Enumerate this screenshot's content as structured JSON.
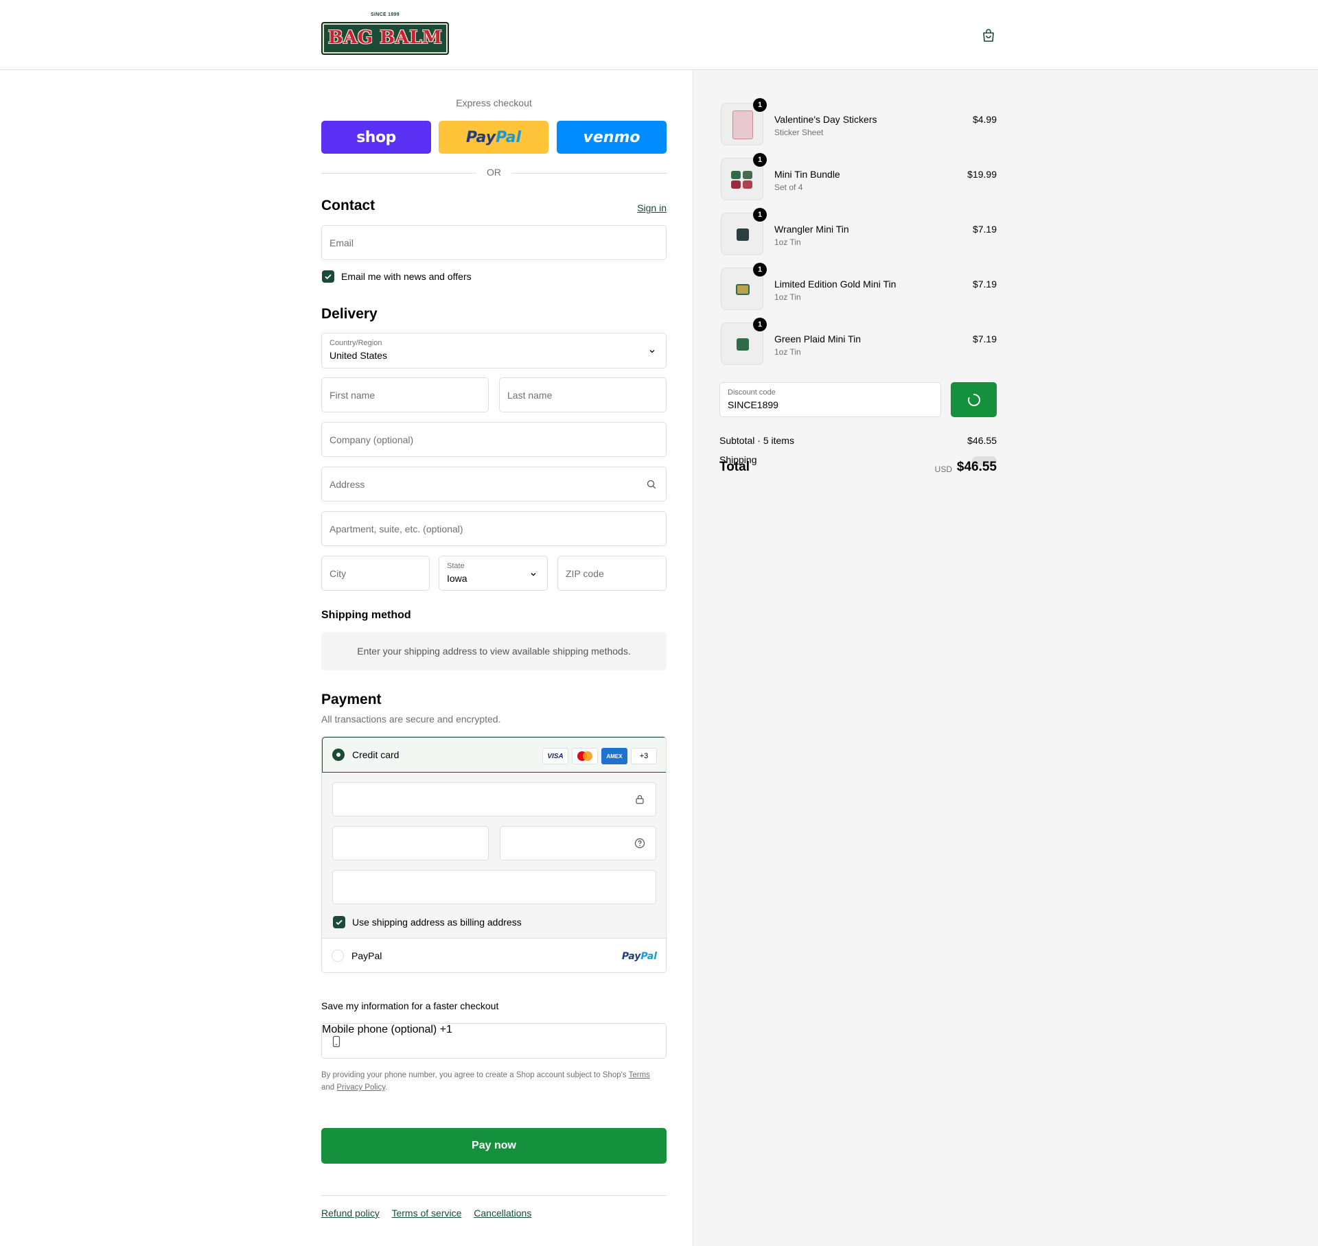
{
  "header": {
    "logo_since": "SINCE 1899",
    "logo_text": "BAG BALM",
    "cart_icon": "shopping-bag-icon"
  },
  "express": {
    "label": "Express checkout",
    "shop_label": "shop",
    "paypal_label_1": "Pay",
    "paypal_label_2": "Pal",
    "venmo_label": "venmo",
    "or_label": "OR"
  },
  "contact": {
    "title": "Contact",
    "sign_in": "Sign in",
    "email_placeholder": "Email",
    "news_checkbox_label": "Email me with news and offers",
    "news_checked": true
  },
  "delivery": {
    "title": "Delivery",
    "country_label": "Country/Region",
    "country_value": "United States",
    "first_name_placeholder": "First name",
    "last_name_placeholder": "Last name",
    "company_placeholder": "Company (optional)",
    "address_placeholder": "Address",
    "apartment_placeholder": "Apartment, suite, etc. (optional)",
    "city_placeholder": "City",
    "state_label": "State",
    "state_value": "Iowa",
    "zip_placeholder": "ZIP code"
  },
  "shipping_method": {
    "title": "Shipping method",
    "info": "Enter your shipping address to view available shipping methods."
  },
  "payment": {
    "title": "Payment",
    "subtitle": "All transactions are secure and encrypted.",
    "credit_card_label": "Credit card",
    "card_logos": [
      "VISA",
      "MC",
      "AMEX",
      "+3"
    ],
    "billing_checkbox_label": "Use shipping address as billing address",
    "billing_checked": true,
    "paypal_label": "PayPal",
    "paypal_logo_1": "Pay",
    "paypal_logo_2": "Pal"
  },
  "save_info": {
    "title": "Save my information for a faster checkout",
    "phone_label": "Mobile phone (optional)",
    "phone_value": "+1",
    "disclaimer_pre": "By providing your phone number, you agree to create a Shop account subject to Shop's ",
    "terms_link": "Terms",
    "disclaimer_and": "and ",
    "privacy_link": "Privacy Policy",
    "disclaimer_end": "."
  },
  "pay_now_label": "Pay now",
  "footer": {
    "links": [
      "Refund policy",
      "Terms of service",
      "Cancellations"
    ]
  },
  "order": {
    "items": [
      {
        "name": "Valentine's Day Stickers",
        "variant": "Sticker Sheet",
        "price": "$4.99",
        "qty": "1",
        "thumb_color": "#e8c9cf"
      },
      {
        "name": "Mini Tin Bundle",
        "variant": "Set of 4",
        "price": "$19.99",
        "qty": "1",
        "thumb_color": "#4a6b52"
      },
      {
        "name": "Wrangler Mini Tin",
        "variant": "1oz Tin",
        "price": "$7.19",
        "qty": "1",
        "thumb_color": "#2c3e44"
      },
      {
        "name": "Limited Edition Gold Mini Tin",
        "variant": "1oz Tin",
        "price": "$7.19",
        "qty": "1",
        "thumb_color": "#b9a24c"
      },
      {
        "name": "Green Plaid Mini Tin",
        "variant": "1oz Tin",
        "price": "$7.19",
        "qty": "1",
        "thumb_color": "#2f6b48"
      }
    ],
    "discount_label": "Discount code",
    "discount_value": "SINCE1899",
    "subtotal_label": "Subtotal · 5 items",
    "subtotal_value": "$46.55",
    "shipping_label": "Shipping",
    "total_label": "Total",
    "total_currency": "USD",
    "total_value": "$46.55"
  },
  "colors": {
    "accent": "#1b4b36",
    "pay_button": "#15913e",
    "shop_pay": "#5a31f4",
    "paypal": "#ffc439",
    "venmo": "#008cff"
  }
}
